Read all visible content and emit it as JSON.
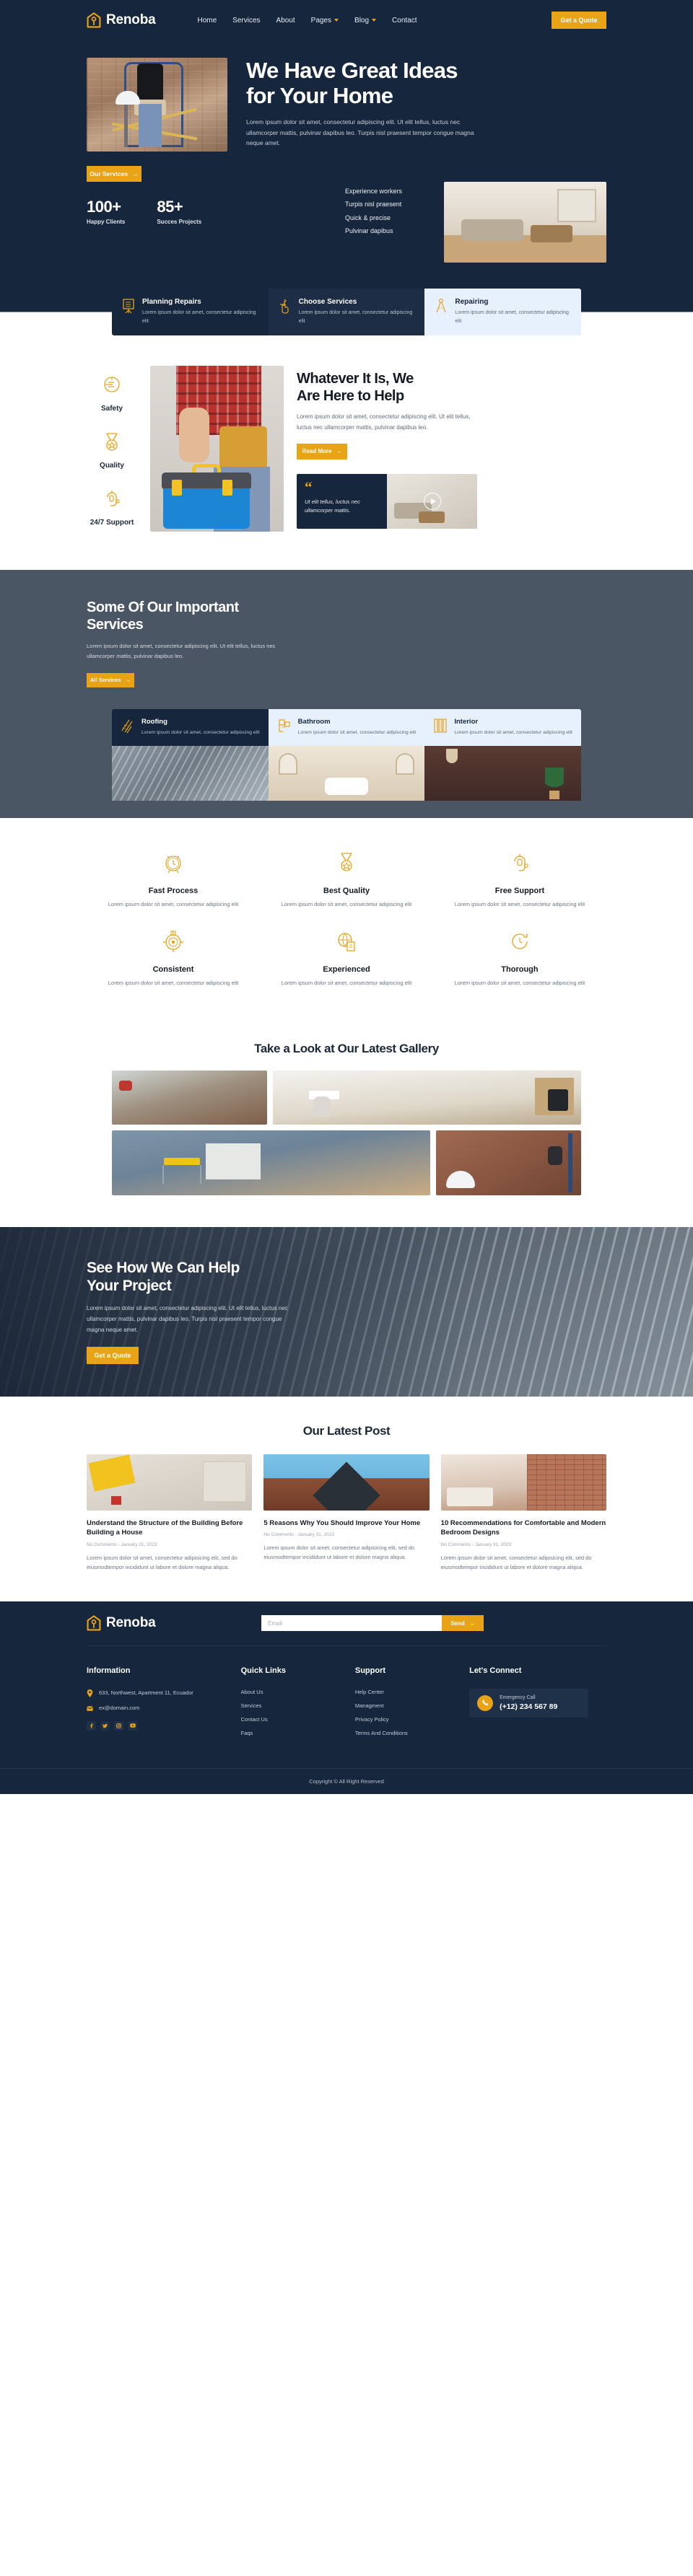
{
  "brand": {
    "name": "Renoba",
    "icon": "house-wrench-logo"
  },
  "nav": {
    "items": [
      {
        "label": "Home",
        "caret": false
      },
      {
        "label": "Services",
        "caret": false
      },
      {
        "label": "About",
        "caret": false
      },
      {
        "label": "Pages",
        "caret": true
      },
      {
        "label": "Blog",
        "caret": true
      },
      {
        "label": "Contact",
        "caret": false
      }
    ],
    "cta": "Get a Quote"
  },
  "hero": {
    "title_line1": "We Have Great Ideas",
    "title_line2": "for Your Home",
    "paragraph": "Lorem ipsum dolor sit amet, consectetur adipiscing elit. Ut elit tellus, luctus nec ullamcorper mattis, pulvinar dapibus leo. Turpis nisl praesent tempor congue magna neque amet.",
    "button": "Our Services",
    "stats": [
      {
        "value": "100+",
        "label": "Happy Clients"
      },
      {
        "value": "85+",
        "label": "Succes Projects"
      }
    ],
    "bullets": [
      "Experience workers",
      "Turpis nisl praesent",
      "Quick & precise",
      "Pulvinar dapibus"
    ]
  },
  "strip": {
    "cards": [
      {
        "icon": "clipboard-checklist-icon",
        "title": "Planning Repairs",
        "desc": "Lorem ipsum dolor sit amet, consectetur adipiscing elit"
      },
      {
        "icon": "hand-pointer-icon",
        "title": "Choose Services",
        "desc": "Lorem ipsum dolor sit amet, consectetur adipiscing elit"
      },
      {
        "icon": "compass-divider-icon",
        "title": "Repairing",
        "desc": "Lorem ipsum dolor sit amet, consectetur adipiscing elit"
      }
    ]
  },
  "help": {
    "rail": [
      {
        "icon": "shield-safety-icon",
        "label": "Safety"
      },
      {
        "icon": "medal-quality-icon",
        "label": "Quality"
      },
      {
        "icon": "headset-support-icon",
        "label": "24/7 Support"
      }
    ],
    "title_line1": "Whatever It Is, We",
    "title_line2": "Are Here to Help",
    "paragraph": "Lorem ipsum dolor sit amet, consectetur adipiscing elit. Ut elit tellus, luctus nec ullamcorper mattis, pulvinar dapibus leo.",
    "button": "Read More",
    "quote_mark": "“",
    "quote": "Ut elit tellus, luctus nec ullamcorper mattis."
  },
  "services": {
    "title_line1": "Some Of Our Important",
    "title_line2": "Services",
    "paragraph": "Lorem ipsum dolor sit amet, consectetur adipiscing elit. Ut elit tellus, luctus nec ullamcorper mattis, pulvinar dapibus leo.",
    "button": "All Services",
    "tabs": [
      {
        "icon": "roof-shingles-icon",
        "title": "Roofing",
        "desc": "Lorem ipsum dolor sit amet, consectetur adipiscing elit"
      },
      {
        "icon": "bathtub-sink-icon",
        "title": "Bathroom",
        "desc": "Lorem ipsum dolor sit amet, consectetur adipiscing elit"
      },
      {
        "icon": "curtain-interior-icon",
        "title": "Interior",
        "desc": "Lorem ipsum dolor sit amet, consectetur adipiscing elit"
      }
    ]
  },
  "features": {
    "items": [
      {
        "icon": "alarm-clock-icon",
        "title": "Fast Process",
        "desc": "Lorem ipsum dolor sit amet, consectetur adipiscing elit"
      },
      {
        "icon": "medal-star-icon",
        "title": "Best Quality",
        "desc": "Lorem ipsum dolor sit amet, consectetur adipiscing elit"
      },
      {
        "icon": "headset-person-icon",
        "title": "Free Support",
        "desc": "Lorem ipsum dolor sit amet, consectetur adipiscing elit"
      },
      {
        "icon": "target-crosshair-icon",
        "title": "Consistent",
        "desc": "Lorem ipsum dolor sit amet, consectetur adipiscing elit"
      },
      {
        "icon": "globe-document-icon",
        "title": "Experienced",
        "desc": "Lorem ipsum dolor sit amet, consectetur adipiscing elit"
      },
      {
        "icon": "clock-arrow-icon",
        "title": "Thorough",
        "desc": "Lorem ipsum dolor sit amet, consectetur adipiscing elit"
      }
    ]
  },
  "gallery": {
    "title": "Take a Look at Our Latest Gallery",
    "images": [
      "worker-sweeping-floor",
      "dining-kitchen-interior",
      "blue-room-renovation-saw",
      "hard-hat-tool-belt-scaffold"
    ]
  },
  "cta": {
    "title_line1": "See How We Can Help",
    "title_line2": "Your Project",
    "paragraph": "Lorem ipsum dolor sit amet, consectetur adipiscing elit. Ut elit tellus, luctus nec ullamcorper mattis, pulvinar dapibus leo. Turpis nisl praesent tempor congue magna neque amet.",
    "button": "Get a Quote"
  },
  "blog": {
    "title": "Our Latest Post",
    "posts": [
      {
        "title": "Understand the Structure of the Building Before Building a House",
        "meta": "No Comments - January 31, 2023",
        "excerpt": "Lorem ipsum dolor sit amet, consectetur adipisicing elit, sed do eiusmodtempor incididunt ut labore et dolore magna aliqua."
      },
      {
        "title": "5 Reasons Why You Should Improve Your Home",
        "meta": "No Comments - January 31, 2023",
        "excerpt": "Lorem ipsum dolor sit amet, consectetur adipisicing elit, sed do eiusmodtempor incididunt ut labore et dolore magna aliqua."
      },
      {
        "title": "10 Recommendations for Comfortable and Modern Bedroom Designs",
        "meta": "No Comments - January 31, 2023",
        "excerpt": "Lorem ipsum dolor sit amet, consectetur adipisicing elit, sed do eiusmodtempor incididunt ut labore et dolore magna aliqua."
      }
    ]
  },
  "footer": {
    "newsletter": {
      "placeholder": "Email",
      "value": "",
      "button": "Send"
    },
    "information": {
      "heading": "Information",
      "address": "633, Northwest, Apartment 11, Ecuador",
      "email": "ex@domain.com",
      "socials": [
        "facebook-icon",
        "twitter-icon",
        "instagram-icon",
        "youtube-icon"
      ]
    },
    "quick_links": {
      "heading": "Quick Links",
      "items": [
        "About Us",
        "Services",
        "Contact Us",
        "Faqs"
      ]
    },
    "support": {
      "heading": "Support",
      "items": [
        "Help Center",
        "Managment",
        "Privacy Policy",
        "Terms And Conditions"
      ]
    },
    "connect": {
      "heading": "Let's Connect",
      "label": "Emergency Call",
      "number": "(+12) 234 567 89"
    },
    "copyright": "Copyright © All Right Reserved"
  },
  "colors": {
    "accent": "#E8A317",
    "dark": "#16263C",
    "slate": "#4B5664",
    "light_blue": "#E7F0FD"
  }
}
